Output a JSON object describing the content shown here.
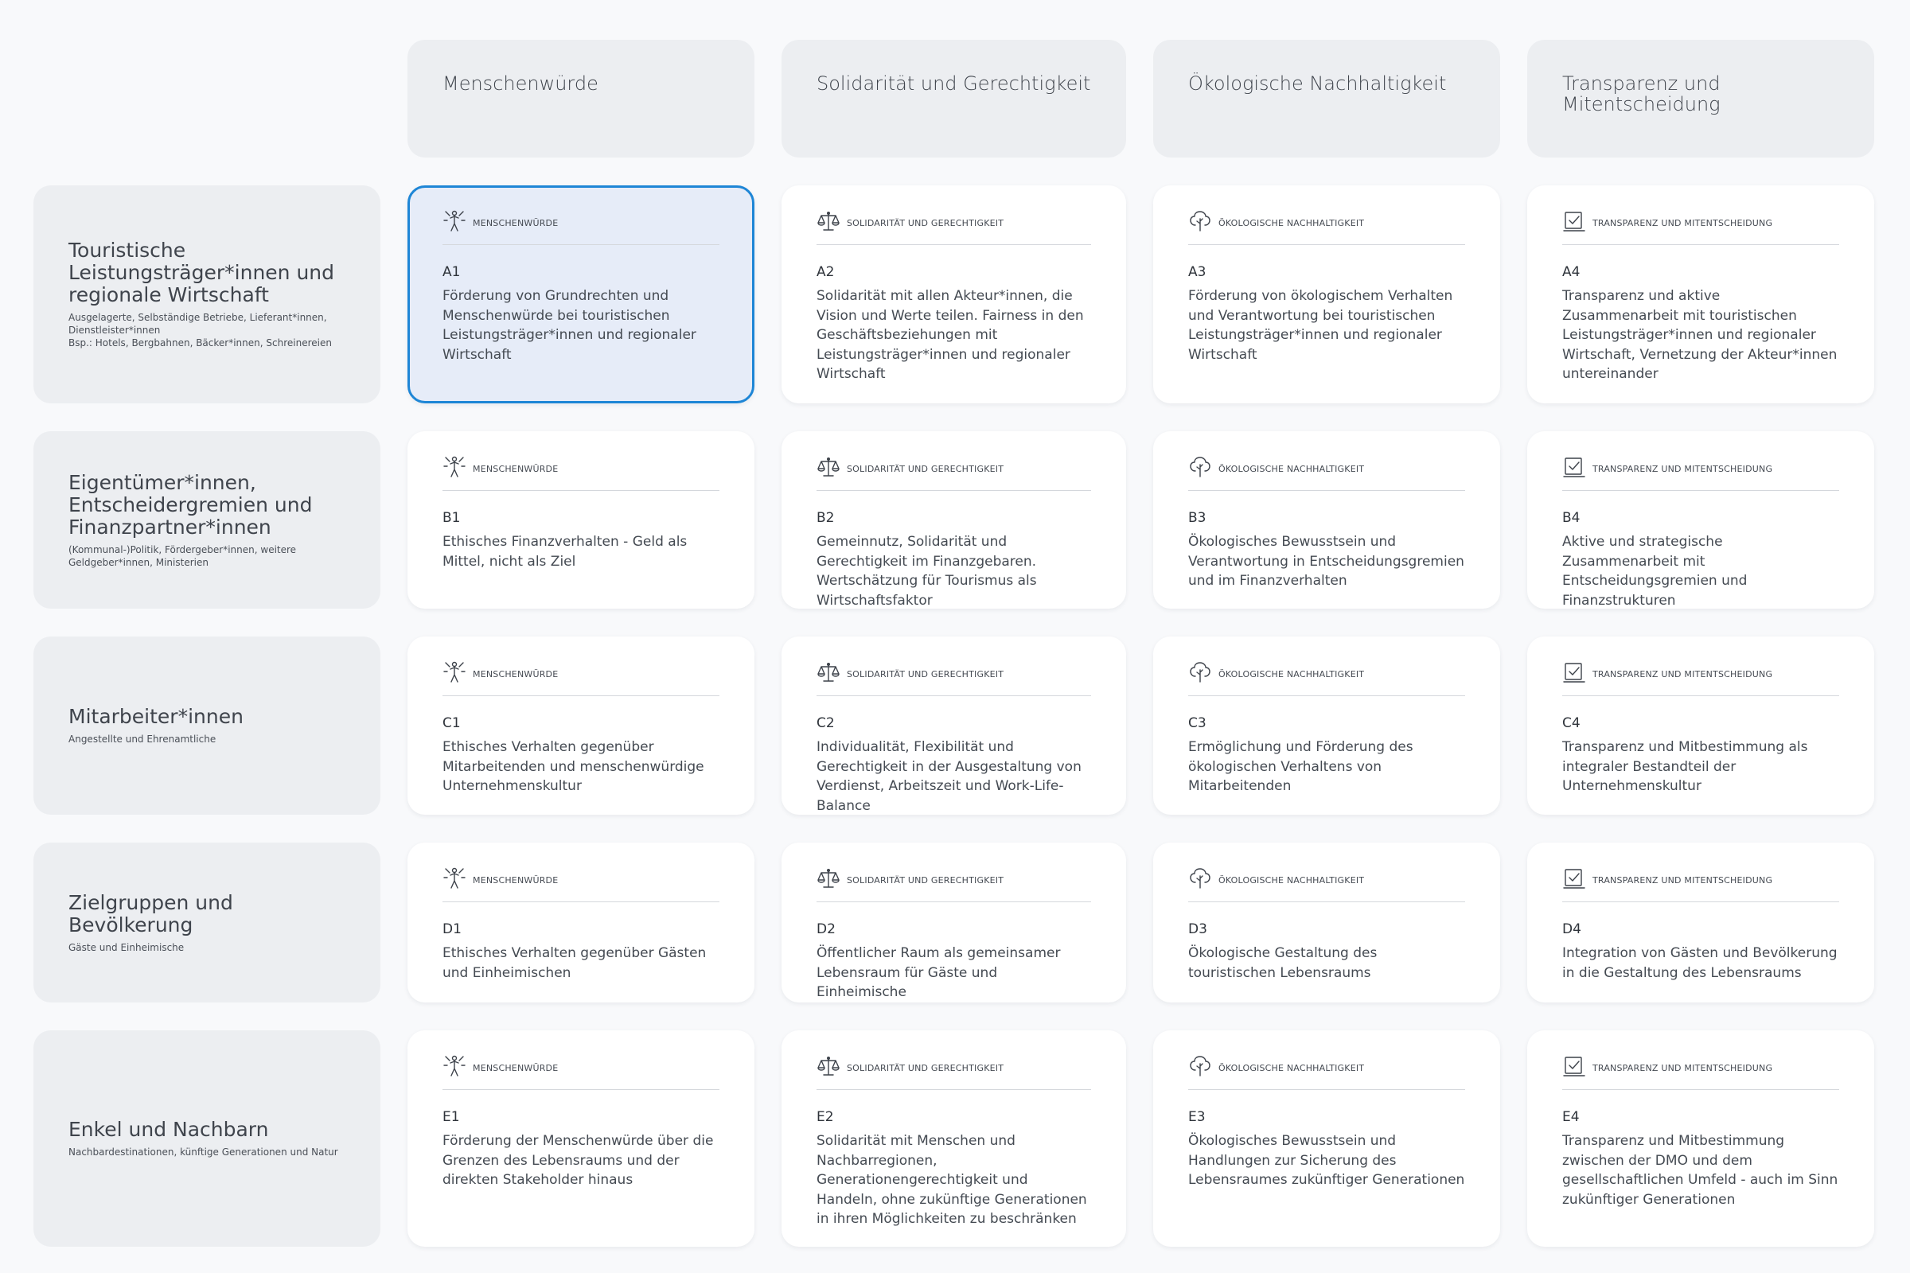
{
  "columns": [
    {
      "title": "Menschenwürde",
      "label": "MENSCHENWÜRDE",
      "icon": "person-icon"
    },
    {
      "title": "Solidarität und Gerechtigkeit",
      "label": "SOLIDARITÄT UND GERECHTIGKEIT",
      "icon": "scales-icon"
    },
    {
      "title": "Ökologische Nachhaltigkeit",
      "label": "ÖKOLOGISCHE NACHHALTIGKEIT",
      "icon": "tree-icon"
    },
    {
      "title": "Transparenz und Mitentscheidung",
      "label": "TRANSPARENZ UND MITENTSCHEIDUNG",
      "icon": "checkbox-icon"
    }
  ],
  "rows": [
    {
      "title": "Touristische Leistungsträger*innen und regionale Wirtschaft",
      "subtitle": "Ausgelagerte, Selbständige Betriebe, Lieferant*innen, Dienstleister*innen",
      "subtitle2": "Bsp.: Hotels, Bergbahnen, Bäcker*innen, Schreinereien",
      "cells": [
        {
          "code": "A1",
          "text": "Förderung von Grundrechten und Menschenwürde bei touristischen Leistungsträger*innen und regionaler Wirtschaft",
          "selected": true
        },
        {
          "code": "A2",
          "text": "Solidarität mit allen Akteur*innen, die Vision und Werte teilen. Fairness in den Geschäftsbeziehungen mit Leistungsträger*innen und regionaler Wirtschaft"
        },
        {
          "code": "A3",
          "text": "Förderung von ökologischem Verhalten und Verantwortung bei touristischen Leistungsträger*innen und regionaler Wirtschaft"
        },
        {
          "code": "A4",
          "text": "Transparenz und aktive Zusammenarbeit mit touristischen Leistungsträger*innen und regionaler Wirtschaft, Vernetzung der Akteur*innen untereinander"
        }
      ]
    },
    {
      "title": "Eigentümer*innen, Entscheidergremien und Finanzpartner*innen",
      "subtitle": "(Kommunal-)Politik, Fördergeber*innen, weitere Geldgeber*innen, Ministerien",
      "subtitle2": "",
      "cells": [
        {
          "code": "B1",
          "text": "Ethisches Finanzverhalten - Geld als Mittel, nicht als Ziel"
        },
        {
          "code": "B2",
          "text": "Gemeinnutz, Solidarität und Gerechtigkeit im Finanzgebaren. Wertschätzung für Tourismus als Wirtschaftsfaktor"
        },
        {
          "code": "B3",
          "text": "Ökologisches Bewusstsein und Verantwortung in Entscheidungsgremien und im Finanzverhalten"
        },
        {
          "code": "B4",
          "text": "Aktive und strategische Zusammenarbeit mit Entscheidungsgremien und Finanzstrukturen"
        }
      ]
    },
    {
      "title": "Mitarbeiter*innen",
      "subtitle": "Angestellte und Ehrenamtliche",
      "subtitle2": "",
      "cells": [
        {
          "code": "C1",
          "text": "Ethisches Verhalten gegenüber Mitarbeitenden und menschenwürdige Unternehmenskultur"
        },
        {
          "code": "C2",
          "text": "Individualität, Flexibilität und Gerechtigkeit in der Ausgestaltung von Verdienst, Arbeitszeit und Work-Life-Balance"
        },
        {
          "code": "C3",
          "text": "Ermöglichung und Förderung des ökologischen Verhaltens von Mitarbeitenden"
        },
        {
          "code": "C4",
          "text": "Transparenz und Mitbestimmung als integraler Bestandteil der Unternehmenskultur"
        }
      ]
    },
    {
      "title": "Zielgruppen und Bevölkerung",
      "subtitle": "Gäste und Einheimische",
      "subtitle2": "",
      "cells": [
        {
          "code": "D1",
          "text": "Ethisches Verhalten gegenüber Gästen und Einheimischen"
        },
        {
          "code": "D2",
          "text": "Öffentlicher Raum als gemeinsamer Lebensraum für Gäste und Einheimische"
        },
        {
          "code": "D3",
          "text": "Ökologische Gestaltung des touristischen Lebensraums"
        },
        {
          "code": "D4",
          "text": "Integration von Gästen und Bevölkerung in die Gestaltung des Lebensraums"
        }
      ]
    },
    {
      "title": "Enkel und Nachbarn",
      "subtitle": "Nachbardestinationen, künftige Generationen und Natur",
      "subtitle2": "",
      "cells": [
        {
          "code": "E1",
          "text": "Förderung der Menschenwürde über die Grenzen des Lebensraums und der direkten Stakeholder hinaus"
        },
        {
          "code": "E2",
          "text": "Solidarität mit Menschen und Nachbarregionen, Generationengerechtigkeit und Handeln, ohne zukünftige Generationen in ihren Möglichkeiten zu beschränken"
        },
        {
          "code": "E3",
          "text": "Ökologisches Bewusstsein und Handlungen zur Sicherung des Lebensraumes zukünftiger Generationen"
        },
        {
          "code": "E4",
          "text": "Transparenz und Mitbestimmung zwischen der DMO und dem gesellschaftlichen Umfeld - auch im Sinn zukünftiger Generationen"
        }
      ]
    }
  ]
}
